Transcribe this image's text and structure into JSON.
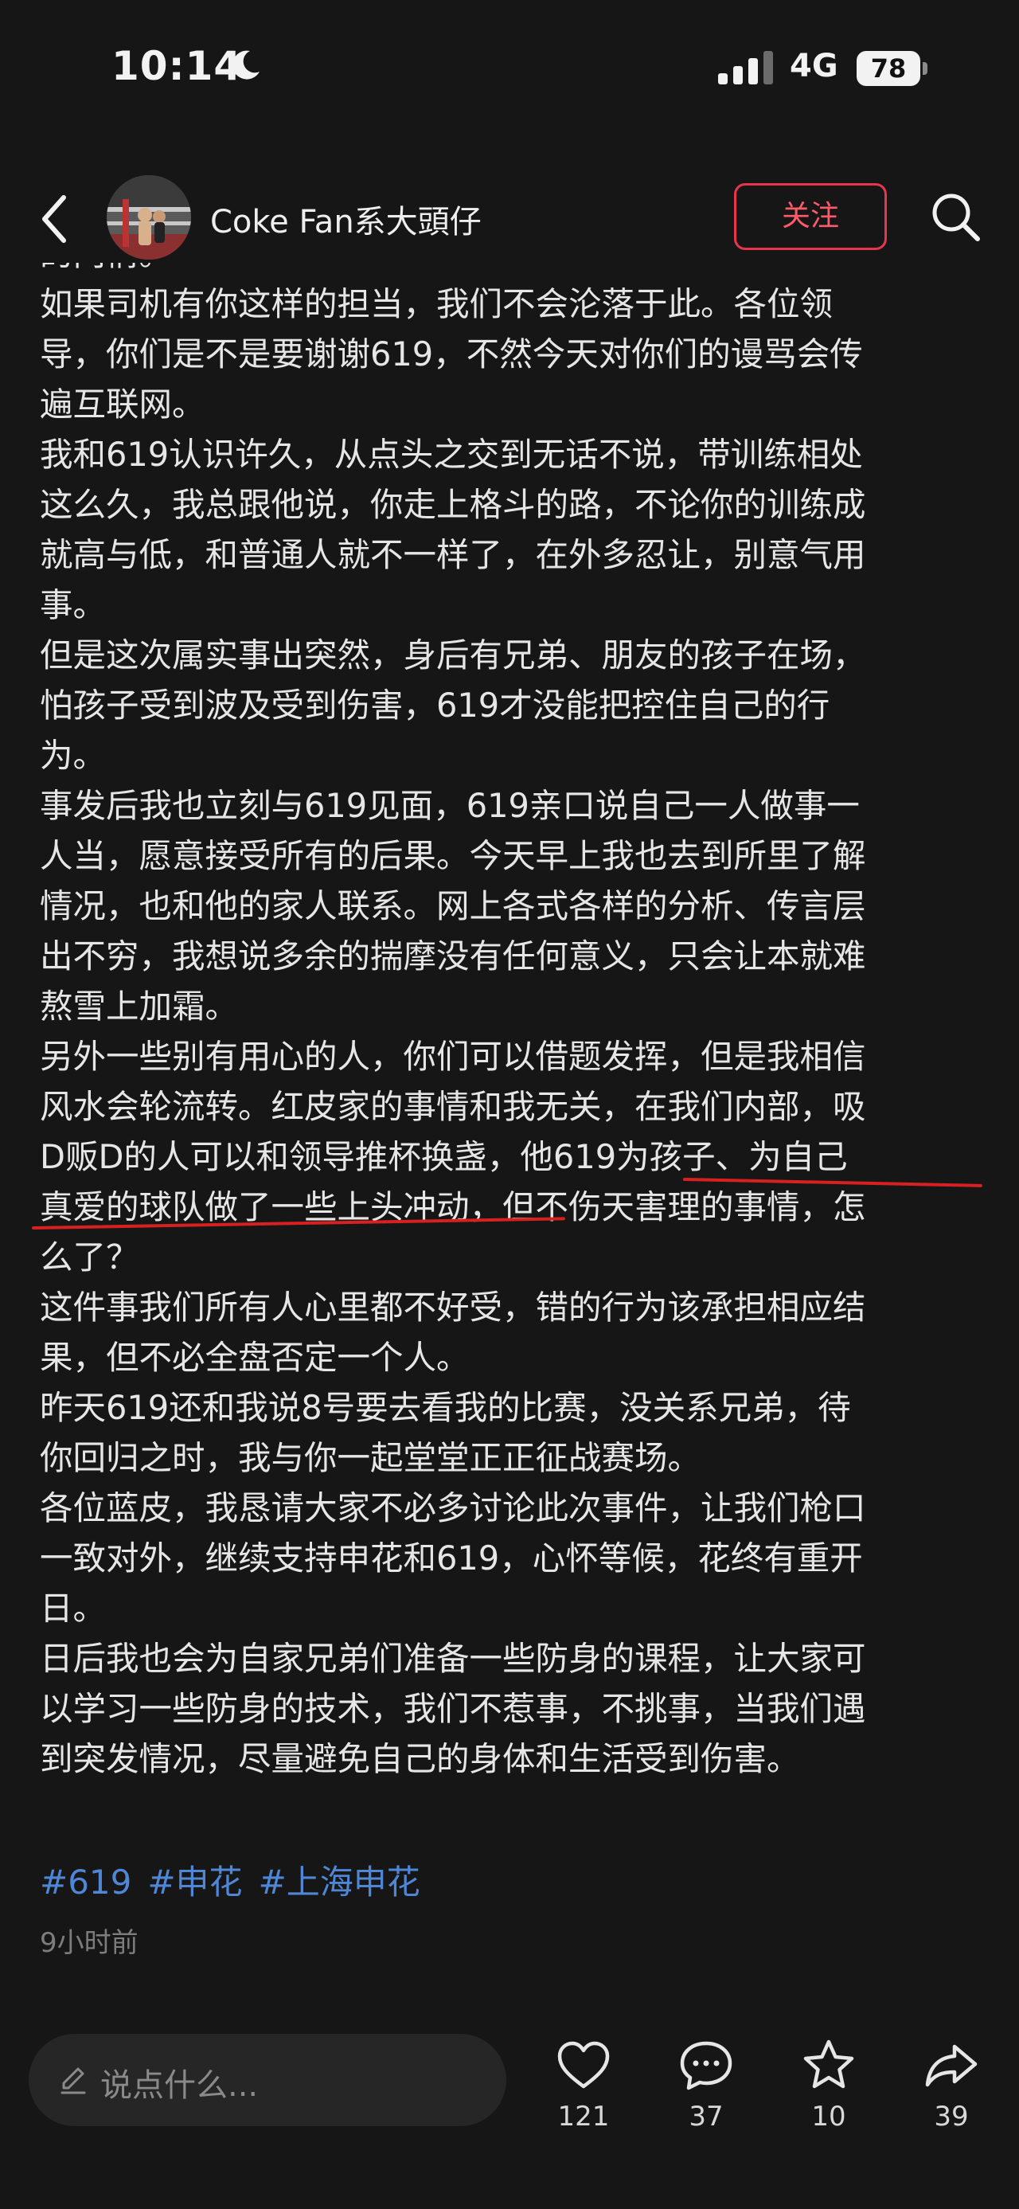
{
  "status_bar": {
    "time": "10:14",
    "network": "4G",
    "battery": "78"
  },
  "header": {
    "author_name": "Coke Fan系大頭仔",
    "follow_label": "关注"
  },
  "post": {
    "lines": [
      "的内情。",
      "如果司机有你这样的担当，我们不会沦落于此。各位领",
      "导，你们是不是要谢谢619，不然今天对你们的谩骂会传",
      "遍互联网。",
      "我和619认识许久，从点头之交到无话不说，带训练相处",
      "这么久，我总跟他说，你走上格斗的路，不论你的训练成",
      "就高与低，和普通人就不一样了，在外多忍让，别意气用",
      "事。",
      "但是这次属实事出突然，身后有兄弟、朋友的孩子在场，",
      "怕孩子受到波及受到伤害，619才没能把控住自己的行",
      "为。",
      "事发后我也立刻与619见面，619亲口说自己一人做事一",
      "人当，愿意接受所有的后果。今天早上我也去到所里了解",
      "情况，也和他的家人联系。网上各式各样的分析、传言层",
      "出不穷，我想说多余的揣摩没有任何意义，只会让本就难",
      "熬雪上加霜。",
      "另外一些别有用心的人，你们可以借题发挥，但是我相信",
      "风水会轮流转。红皮家的事情和我无关，在我们内部，吸",
      "D贩D的人可以和领导推杯换盏，他619为孩子、为自己",
      "真爱的球队做了一些上头冲动，但不伤天害理的事情，怎",
      "么了？",
      "这件事我们所有人心里都不好受，错的行为该承担相应结",
      "果，但不必全盘否定一个人。",
      "昨天619还和我说8号要去看我的比赛，没关系兄弟，待",
      "你回归之时，我与你一起堂堂正正征战赛场。",
      "各位蓝皮，我恳请大家不必多讨论此次事件，让我们枪口",
      "一致对外，继续支持申花和619，心怀等候，花终有重开",
      "日。",
      "日后我也会为自家兄弟们准备一些防身的课程，让大家可",
      "以学习一些防身的技术，我们不惹事，不挑事，当我们遇",
      "到突发情况，尽量避免自己的身体和生活受到伤害。"
    ],
    "hashtags": [
      "#619",
      "#申花",
      "#上海申花"
    ],
    "timestamp": "9小时前"
  },
  "bottom_bar": {
    "comment_placeholder": "说点什么...",
    "like_count": "121",
    "comment_count": "37",
    "favorite_count": "10",
    "share_count": "39"
  },
  "colors": {
    "background": "#161616",
    "follow_accent": "#e8344f",
    "hashtag": "#4f86d6",
    "underline_mark": "#d82020"
  }
}
